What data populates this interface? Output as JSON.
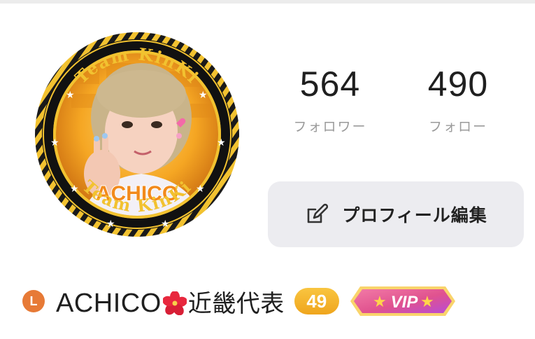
{
  "profile": {
    "avatar_ring_text_top": "Team KinKi",
    "avatar_ring_text_left": "Team KinKi",
    "avatar_ring_text_right": "Team KinKi",
    "avatar_ring_text_bottom": "Team KinKi",
    "avatar_caption": "ACHICO",
    "username": "ACHICO",
    "name_suffix": "近畿代表",
    "level_letter": "L",
    "count_badge": "49",
    "vip_label": "VIP"
  },
  "stats": {
    "followers_count": "564",
    "followers_label": "フォロワー",
    "following_count": "490",
    "following_label": "フォロー"
  },
  "actions": {
    "edit_profile_label": "プロフィール編集"
  },
  "icons": {
    "edit": "pencil-square-icon",
    "level": "level-l-icon",
    "flower": "hibiscus-icon",
    "vip_star": "star-icon"
  },
  "colors": {
    "level_orange": "#e77a36",
    "badge_gold": "#f2b02a",
    "vip_pink": "#e0528f",
    "button_bg": "#ececf0"
  }
}
